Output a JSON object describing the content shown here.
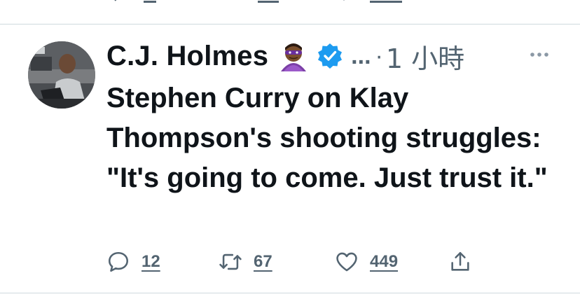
{
  "tweet": {
    "author_name": "C.J. Holmes",
    "emoji": "superhero-emoji",
    "verified": true,
    "handle": "...",
    "separator": "·",
    "time": "1 小時",
    "text": "Stephen Curry on Klay Thompson's shooting struggles: \"It's going to come. Just trust it.\"",
    "actions": {
      "replies": "12",
      "retweets": "67",
      "likes": "449"
    }
  },
  "colors": {
    "text": "#0f1419",
    "secondary": "#536471",
    "verified": "#1d9bf0",
    "divider": "#cfd9de"
  }
}
